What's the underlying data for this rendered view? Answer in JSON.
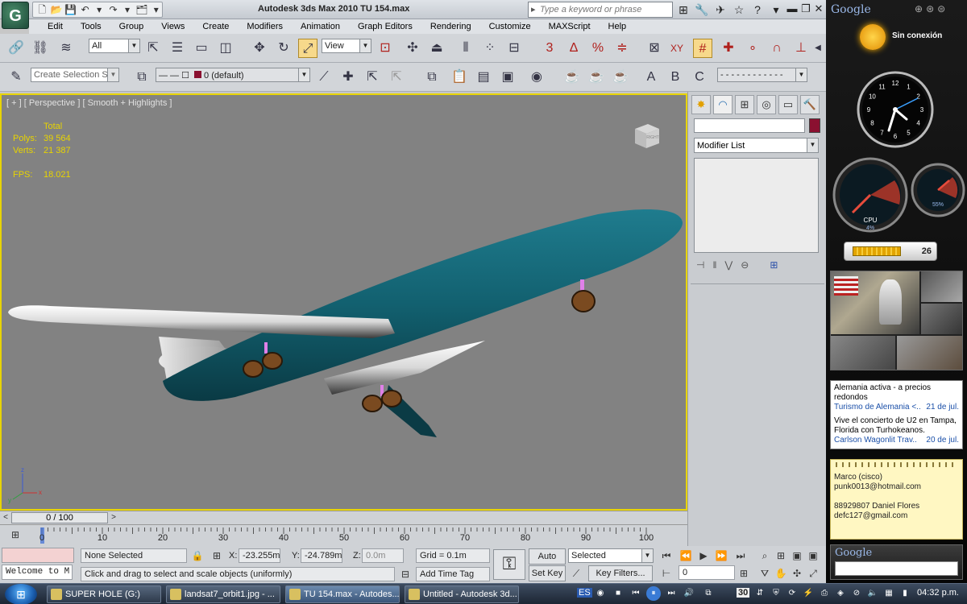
{
  "window": {
    "title": "Autodesk 3ds Max  2010      TU 154.max",
    "app_logo": "G"
  },
  "search": {
    "placeholder": "Type a keyword or phrase"
  },
  "menu": [
    "Edit",
    "Tools",
    "Group",
    "Views",
    "Create",
    "Modifiers",
    "Animation",
    "Graph Editors",
    "Rendering",
    "Customize",
    "MAXScript",
    "Help"
  ],
  "toolbar": {
    "selection_filter": "All",
    "reference_coord": "View",
    "named_selection_set": "Create Selection Se",
    "layer": "0 (default)",
    "snap_labels": {
      "snap3": "3",
      "angle": "∆",
      "percent": "%",
      "spinner": "≑",
      "xy": "XY"
    },
    "abc": {
      "a": "A",
      "b": "B",
      "c": "C"
    }
  },
  "viewport": {
    "label": "[ + ] [ Perspective ] [ Smooth + Highlights ]",
    "stats": {
      "header": "Total",
      "polys_label": "Polys:",
      "polys": "39 564",
      "verts_label": "Verts:",
      "verts": "21 387",
      "fps_label": "FPS:",
      "fps": "18.021"
    },
    "viewcube_label": "RIGHT",
    "axis": {
      "x": "x",
      "y": "y",
      "z": "z"
    }
  },
  "timeline": {
    "slider_text": "0 / 100",
    "ticks": [
      "0",
      "10",
      "20",
      "30",
      "40",
      "50",
      "60",
      "70",
      "80",
      "90",
      "100"
    ]
  },
  "status": {
    "maxscript_listener": "Welcome to M",
    "selection": "None Selected",
    "prompt": "Click and drag to select and scale objects (uniformly)",
    "x_label": "X:",
    "x_value": "-23.255m",
    "y_label": "Y:",
    "y_value": "-24.789m",
    "z_label": "Z:",
    "z_value": "0.0m",
    "grid": "Grid = 0.1m",
    "add_time_tag": "Add Time Tag",
    "auto_key": "Auto Key",
    "set_key": "Set Key",
    "key_mode": "Selected",
    "key_filters": "Key Filters...",
    "current_frame": "0"
  },
  "command_panel": {
    "modifier_list": "Modifier List",
    "object_color": "#8a1030"
  },
  "taskbar": {
    "items": [
      "SUPER HOLE (G:)",
      "landsat7_orbit1.jpg - ...",
      "TU 154.max - Autodes...",
      "Untitled - Autodesk 3d..."
    ],
    "language": "ES",
    "date_day": "30",
    "clock": "04:32 p.m."
  },
  "sidebar": {
    "google": "Google",
    "weather": "Sin conexión",
    "clock_numbers": [
      "12",
      "1",
      "2",
      "3",
      "4",
      "5",
      "6",
      "7",
      "8",
      "9",
      "10",
      "11"
    ],
    "cpu_label": "CPU",
    "cpu_value": "4%",
    "ram_value": "55%",
    "battery_value": "26",
    "battery_level": 0.75,
    "news": [
      {
        "title": "Alemania activa - a precios redondos",
        "source": "Turismo de Alemania <..",
        "date": "21 de jul."
      },
      {
        "title": "Vive el concierto de U2 en Tampa, Florida con Turhokeanos.",
        "source": "Carlson Wagonlit Trav..",
        "date": "20 de jul."
      }
    ],
    "notes": [
      "Marco (cisco)",
      "punk0013@hotmail.com",
      "",
      "88929807 Daniel Flores",
      "defc127@gmail.com"
    ],
    "search_label": "Google"
  }
}
